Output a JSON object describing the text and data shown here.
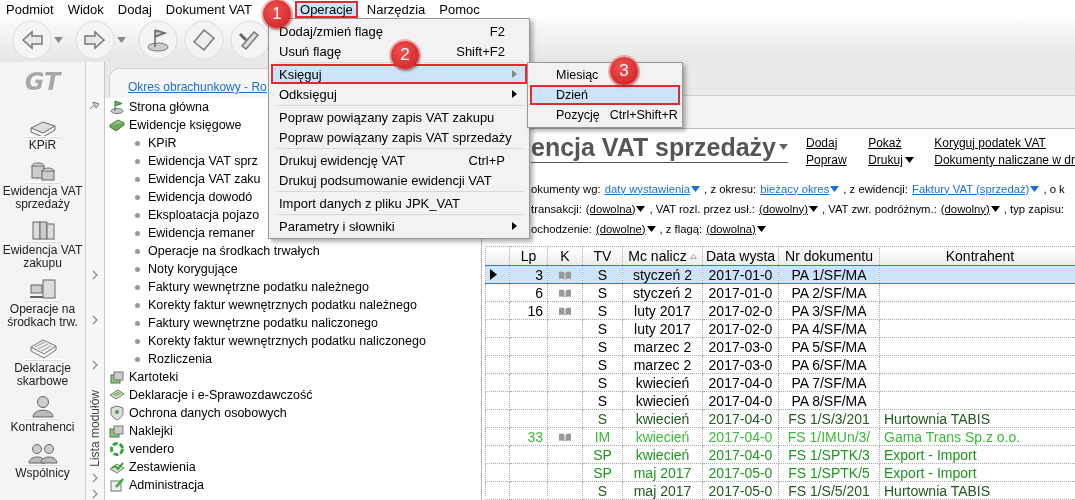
{
  "menubar": [
    {
      "label": "Podmiot",
      "selected": false
    },
    {
      "label": "Widok",
      "selected": false
    },
    {
      "label": "Dodaj",
      "selected": false
    },
    {
      "label": "Dokument VAT",
      "selected": false
    },
    {
      "label": "Operacje",
      "selected": true
    },
    {
      "label": "Narzędzia",
      "selected": false
    },
    {
      "label": "Pomoc",
      "selected": false
    }
  ],
  "logo": "GT",
  "modules": [
    {
      "label": "KPiR"
    },
    {
      "label": "Ewidencja VAT sprzedaży"
    },
    {
      "label": "Ewidencja VAT zakupu"
    },
    {
      "label": "Operacje na środkach trw."
    },
    {
      "label": "Deklaracje skarbowe"
    },
    {
      "label": "Kontrahenci"
    },
    {
      "label": "Wspólnicy"
    }
  ],
  "strip": {
    "label": "Lista modułów"
  },
  "period_link": "Okres obrachunkowy - Ro",
  "tree": [
    {
      "label": "Strona główna"
    },
    {
      "label": "Ewidencje księgowe",
      "children": [
        {
          "label": "KPiR"
        },
        {
          "label": "Ewidencja VAT sprz"
        },
        {
          "label": "Ewidencja VAT zaku"
        },
        {
          "label": "Ewidencja dowodó"
        },
        {
          "label": "Eksploatacja pojazo"
        },
        {
          "label": "Ewidencja remaner"
        },
        {
          "label": "Operacje na środkach trwałych"
        },
        {
          "label": "Noty korygujące"
        },
        {
          "label": "Faktury wewnętrzne podatku należnego"
        },
        {
          "label": "Korekty faktur wewnętrznych podatku należnego"
        },
        {
          "label": "Faktury wewnętrzne podatku naliczonego"
        },
        {
          "label": "Korekty faktur wewnętrznych podatku naliczonego"
        },
        {
          "label": "Rozliczenia"
        }
      ]
    },
    {
      "label": "Kartoteki"
    },
    {
      "label": "Deklaracje i e-Sprawozdawczość"
    },
    {
      "label": "Ochrona danych osobowych"
    },
    {
      "label": "Naklejki"
    },
    {
      "label": "vendero"
    },
    {
      "label": "Zestawienia"
    },
    {
      "label": "Administracja"
    }
  ],
  "document": {
    "title": "encja VAT sprzedaży",
    "action_columns": [
      {
        "items": [
          {
            "label": "Dodaj",
            "dropdown": false
          },
          {
            "label": "Popraw",
            "dropdown": false
          }
        ]
      },
      {
        "items": [
          {
            "label": "Pokaż",
            "dropdown": false
          },
          {
            "label": "Drukuj",
            "dropdown": true
          }
        ]
      },
      {
        "items": [
          {
            "label": "Koryguj podatek VAT",
            "dropdown": false
          },
          {
            "label": "Dokumenty naliczane w dr",
            "dropdown": false
          }
        ]
      }
    ],
    "filters": [
      [
        {
          "kind": "label",
          "text": "okumenty wg:"
        },
        {
          "kind": "link",
          "text": "daty wystawienia"
        },
        {
          "kind": "label",
          "text": ", z okresu:"
        },
        {
          "kind": "link",
          "text": "bieżący okres"
        },
        {
          "kind": "label",
          "text": ", z ewidencji:"
        },
        {
          "kind": "link",
          "text": "Faktury VAT (sprzedaż)"
        },
        {
          "kind": "label",
          "text": ", o k"
        }
      ],
      [
        {
          "kind": "label",
          "text": "transakcji:"
        },
        {
          "kind": "choice",
          "text": "(dowolna)"
        },
        {
          "kind": "label",
          "text": ", VAT rozl. przez usł.:"
        },
        {
          "kind": "choice",
          "text": "(dowolny)"
        },
        {
          "kind": "label",
          "text": ", VAT zwr. podróżnym.:"
        },
        {
          "kind": "choice",
          "text": "(dowolny)"
        },
        {
          "kind": "label",
          "text": ", typ zapisu:"
        }
      ],
      [
        {
          "kind": "label",
          "text": "ochodzenie:"
        },
        {
          "kind": "choice",
          "text": "(dowolne)"
        },
        {
          "kind": "label",
          "text": ", z flagą:"
        },
        {
          "kind": "choice",
          "text": "(dowolna)"
        }
      ]
    ]
  },
  "table": {
    "columns": [
      {
        "label": "Lp",
        "sorted": false
      },
      {
        "label": "K",
        "sorted": false
      },
      {
        "label": "TV",
        "sorted": false
      },
      {
        "label": "Mc nalicz",
        "sorted": true
      },
      {
        "label": "Data wysta",
        "sorted": false
      },
      {
        "label": "Nr dokumentu",
        "sorted": false
      },
      {
        "label": "Kontrahent",
        "sorted": false
      }
    ],
    "rows": [
      {
        "selected": true,
        "color": "#000000",
        "lp": "3",
        "booked": true,
        "tv": "S",
        "month": "styczeń 2",
        "date": "2017-01-0",
        "number": "PA 1/SF/MA"
      },
      {
        "selected": false,
        "color": "#000000",
        "lp": "6",
        "booked": true,
        "tv": "S",
        "month": "styczeń 2",
        "date": "2017-01-0",
        "number": "PA 2/SF/MA"
      },
      {
        "selected": false,
        "color": "#000000",
        "lp": "16",
        "booked": true,
        "tv": "S",
        "month": "luty 2017",
        "date": "2017-02-0",
        "number": "PA 3/SF/MA"
      },
      {
        "selected": false,
        "color": "#000000",
        "booked": false,
        "tv": "S",
        "month": "luty 2017",
        "date": "2017-02-0",
        "number": "PA 4/SF/MA"
      },
      {
        "selected": false,
        "color": "#000000",
        "booked": false,
        "tv": "S",
        "month": "marzec 2",
        "date": "2017-03-0",
        "number": "PA 5/SF/MA"
      },
      {
        "selected": false,
        "color": "#000000",
        "booked": false,
        "tv": "S",
        "month": "marzec 2",
        "date": "2017-03-0",
        "number": "PA 6/SF/MA"
      },
      {
        "selected": false,
        "color": "#000000",
        "booked": false,
        "tv": "S",
        "month": "kwiecień",
        "date": "2017-04-0",
        "number": "PA 7/SF/MA"
      },
      {
        "selected": false,
        "color": "#000000",
        "booked": false,
        "tv": "S",
        "month": "kwiecień",
        "date": "2017-04-0",
        "number": "PA 8/SF/MA"
      },
      {
        "selected": false,
        "color": "#1f5a1f",
        "booked": false,
        "tv": "S",
        "month": "kwiecień",
        "date": "2017-04-0",
        "number": "FS 1/S/3/201",
        "contractor": "Hurtownia TABIS"
      },
      {
        "selected": false,
        "color": "#3cb83c",
        "lp": "33",
        "booked": true,
        "tv": "IM",
        "month": "kwiecień",
        "date": "2017-04-0",
        "number": "FS 1/IMUn/3/",
        "contractor": "Gama Trans Sp.z o.o."
      },
      {
        "selected": false,
        "color": "#1e961e",
        "booked": false,
        "tv": "SP",
        "month": "kwiecień",
        "date": "2017-04-0",
        "number": "FS 1/SPTK/3",
        "contractor": "Export - Import"
      },
      {
        "selected": false,
        "color": "#1e961e",
        "booked": false,
        "tv": "SP",
        "month": "maj 2017",
        "date": "2017-05-0",
        "number": "FS 1/SPTK/5",
        "contractor": "Export - Import"
      },
      {
        "selected": false,
        "color": "#1f5a1f",
        "booked": false,
        "tv": "S",
        "month": "maj 2017",
        "date": "2017-05-0",
        "number": "FS 1/S/5/201",
        "contractor": "Hurtownia TABIS"
      }
    ]
  },
  "menu": [
    {
      "kind": "item",
      "label": "Dodaj/zmień flagę",
      "shortcut": "F2",
      "submenu": false,
      "selected": false
    },
    {
      "kind": "item",
      "label": "Usuń flagę",
      "shortcut": "Shift+F2",
      "submenu": false,
      "selected": false
    },
    {
      "kind": "separator"
    },
    {
      "kind": "item",
      "label": "Księguj",
      "submenu": true,
      "selected": true
    },
    {
      "kind": "item",
      "label": "Odksięguj",
      "submenu": true,
      "selected": false
    },
    {
      "kind": "separator"
    },
    {
      "kind": "item",
      "label": "Popraw powiązany zapis VAT zakupu",
      "submenu": false,
      "selected": false
    },
    {
      "kind": "item",
      "label": "Popraw powiązany zapis VAT sprzedaży",
      "submenu": false,
      "selected": false
    },
    {
      "kind": "separator"
    },
    {
      "kind": "item",
      "label": "Drukuj ewidencję VAT",
      "shortcut": "Ctrl+P",
      "submenu": false,
      "selected": false
    },
    {
      "kind": "item",
      "label": "Drukuj podsumowanie ewidencji VAT",
      "submenu": false,
      "selected": false
    },
    {
      "kind": "separator"
    },
    {
      "kind": "item",
      "label": "Import danych z pliku JPK_VAT",
      "submenu": false,
      "selected": false
    },
    {
      "kind": "separator"
    },
    {
      "kind": "item",
      "label": "Parametry i słowniki",
      "submenu": true,
      "selected": false
    }
  ],
  "submenu": [
    {
      "label": "Miesiąc",
      "selected": false
    },
    {
      "label": "Dzień",
      "selected": true
    },
    {
      "label": "Pozycję",
      "shortcut": "Ctrl+Shift+R",
      "selected": false
    }
  ],
  "callouts": [
    "1",
    "2",
    "3"
  ]
}
